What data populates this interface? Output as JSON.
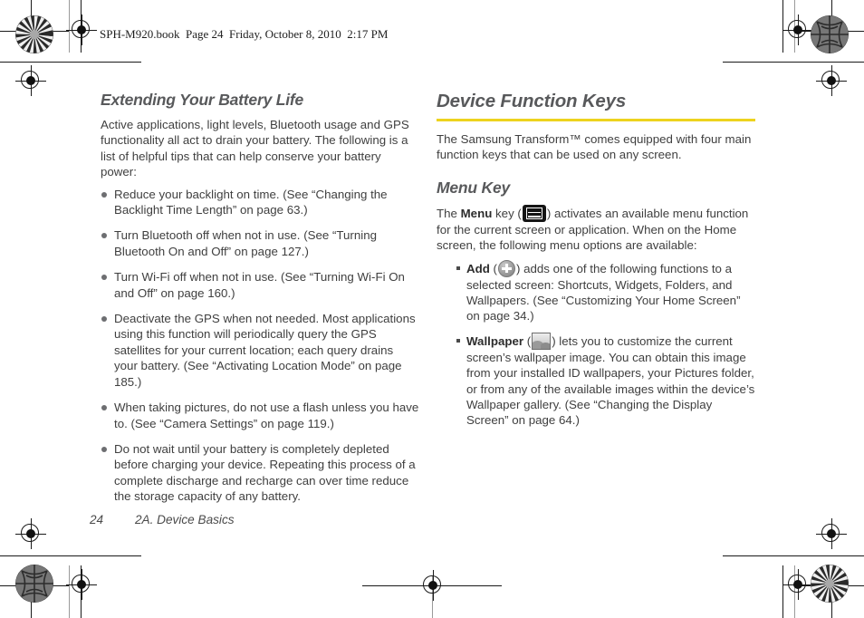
{
  "book_header": "SPH-M920.book  Page 24  Friday, October 8, 2010  2:17 PM",
  "colors": {
    "rule": "#EDD31E",
    "heading": "#58595B",
    "body": "#3F3F3F"
  },
  "left_column": {
    "heading": "Extending Your Battery Life",
    "intro": "Active applications, light levels, Bluetooth usage and GPS functionality all act to drain your battery. The following is a list of helpful tips that can help conserve your battery power:",
    "bullets": [
      "Reduce your backlight on time. (See “Changing the Backlight Time Length” on page 63.)",
      "Turn Bluetooth off when not in use. (See “Turning Bluetooth On and Off” on page 127.)",
      "Turn Wi-Fi off when not in use. (See “Turning Wi-Fi On and Off” on page 160.)",
      "Deactivate the GPS when not needed. Most applications using this function will periodically query the GPS satellites for your current location; each query drains your battery. (See “Activating Location Mode” on page 185.)",
      "When taking pictures, do not use a flash unless you have to. (See “Camera Settings” on page 119.)",
      "Do not wait until your battery is completely depleted before charging your device. Repeating this process of a complete discharge and recharge can over time reduce the storage capacity of any battery."
    ]
  },
  "right_column": {
    "heading": "Device Function Keys",
    "intro": "The Samsung Transform™ comes equipped with four main function keys that can be used on any screen.",
    "subheading": "Menu Key",
    "menu_key_paragraph": {
      "before_bold": "The ",
      "bold": "Menu",
      "after_bold": " key (",
      "icon": "menu-key-icon",
      "after_icon": ") activates an available menu function for the current screen or application. When on the Home screen, the following menu options are available:"
    },
    "options": [
      {
        "label": "Add",
        "icon": "add-icon",
        "text": ") adds one of the following functions to a selected screen: Shortcuts, Widgets, Folders, and Wallpapers. (See “Customizing Your Home Screen” on page 34.)"
      },
      {
        "label": "Wallpaper",
        "icon": "wallpaper-icon",
        "text": ") lets you to customize the current screen’s wallpaper image. You can obtain this image from your installed ID wallpapers, your Pictures folder, or from any of the available images within the device’s Wallpaper gallery. (See “Changing the Display Screen” on page 64.)"
      }
    ],
    "open_paren": " ("
  },
  "footer": {
    "page_number": "24",
    "chapter": "2A. Device Basics"
  }
}
